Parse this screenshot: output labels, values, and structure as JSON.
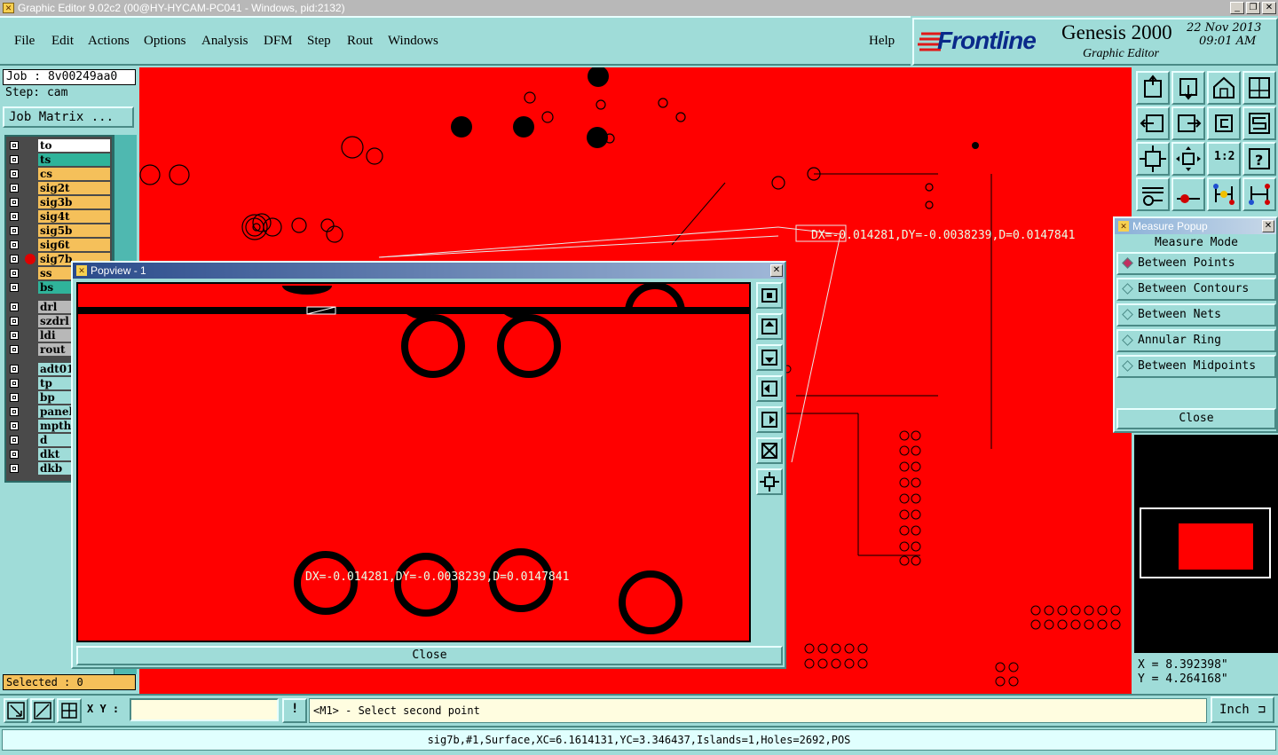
{
  "window": {
    "title": "Graphic Editor 9.02c2 (00@HY-HYCAM-PC041 - Windows, pid:2132)"
  },
  "menu": [
    "File",
    "Edit",
    "Actions",
    "Options",
    "Analysis",
    "DFM",
    "Step",
    "Rout",
    "Windows"
  ],
  "help_label": "Help",
  "brand": {
    "logo": "Frontline",
    "product": "Genesis 2000",
    "subtitle": "Graphic Editor",
    "date": "22 Nov 2013",
    "time": "09:01 AM"
  },
  "job": {
    "job_line": "Job : 8v00249aa0",
    "step_line": "Step: cam",
    "matrix_button": "Job Matrix ..."
  },
  "layers": [
    {
      "name": "to",
      "color": "#ffffff",
      "arrow": true
    },
    {
      "name": "ts",
      "color": "#2fb39a",
      "arrow": false
    },
    {
      "name": "cs",
      "color": "#f5c05a",
      "arrow": true
    },
    {
      "name": "sig2t",
      "color": "#f5c05a",
      "arrow": true
    },
    {
      "name": "sig3b",
      "color": "#f5c05a",
      "arrow": true
    },
    {
      "name": "sig4t",
      "color": "#f5c05a",
      "arrow": true
    },
    {
      "name": "sig5b",
      "color": "#f5c05a",
      "arrow": true
    },
    {
      "name": "sig6t",
      "color": "#f5c05a",
      "arrow": true
    },
    {
      "name": "sig7b",
      "color": "#f5c05a",
      "arrow": true,
      "active": true
    },
    {
      "name": "ss",
      "color": "#f5c05a",
      "arrow": false
    },
    {
      "name": "bs",
      "color": "#2fb39a",
      "arrow": false
    },
    {
      "name": "drl",
      "color": "#b8b8b8",
      "arrow": false
    },
    {
      "name": "szdrl",
      "color": "#b8b8b8",
      "arrow": false
    },
    {
      "name": "ldi",
      "color": "#b8b8b8",
      "arrow": false
    },
    {
      "name": "rout",
      "color": "#b8b8b8",
      "arrow": false
    },
    {
      "name": "adt01",
      "color": "#9fdcd8",
      "arrow": false
    },
    {
      "name": "tp",
      "color": "#9fdcd8",
      "arrow": false
    },
    {
      "name": "bp",
      "color": "#9fdcd8",
      "arrow": false
    },
    {
      "name": "panel",
      "color": "#9fdcd8",
      "arrow": false
    },
    {
      "name": "mpth",
      "color": "#9fdcd8",
      "arrow": false
    },
    {
      "name": "d",
      "color": "#9fdcd8",
      "arrow": false
    },
    {
      "name": "dkt",
      "color": "#9fdcd8",
      "arrow": false
    },
    {
      "name": "dkb",
      "color": "#9fdcd8",
      "arrow": false
    }
  ],
  "selected_text": "Selected : 0",
  "measure_readout": "DX=-0.014281,DY=-0.0038239,D=0.0147841",
  "popview": {
    "title": "Popview - 1",
    "close_label": "Close"
  },
  "measure_popup": {
    "title": "Measure Popup",
    "heading": "Measure Mode",
    "options": [
      {
        "label": "Between Points",
        "selected": true
      },
      {
        "label": "Between Contours",
        "selected": false
      },
      {
        "label": "Between Nets",
        "selected": false
      },
      {
        "label": "Annular Ring",
        "selected": false
      },
      {
        "label": "Between Midpoints",
        "selected": false
      }
    ],
    "close_label": "Close"
  },
  "coords": {
    "x": "X = 8.392398\"",
    "y": "Y = 4.264168\""
  },
  "bottom": {
    "xy_label": "X Y :",
    "xy_value": "",
    "prompt": "<M1> - Select second point",
    "units": "Inch"
  },
  "status": "sig7b,#1,Surface,XC=6.1614131,YC=3.346437,Islands=1,Holes=2692,POS",
  "colors": {
    "panel": "#9fdcd8",
    "canvas": "#ff0000",
    "selection": "#f5c05a"
  }
}
